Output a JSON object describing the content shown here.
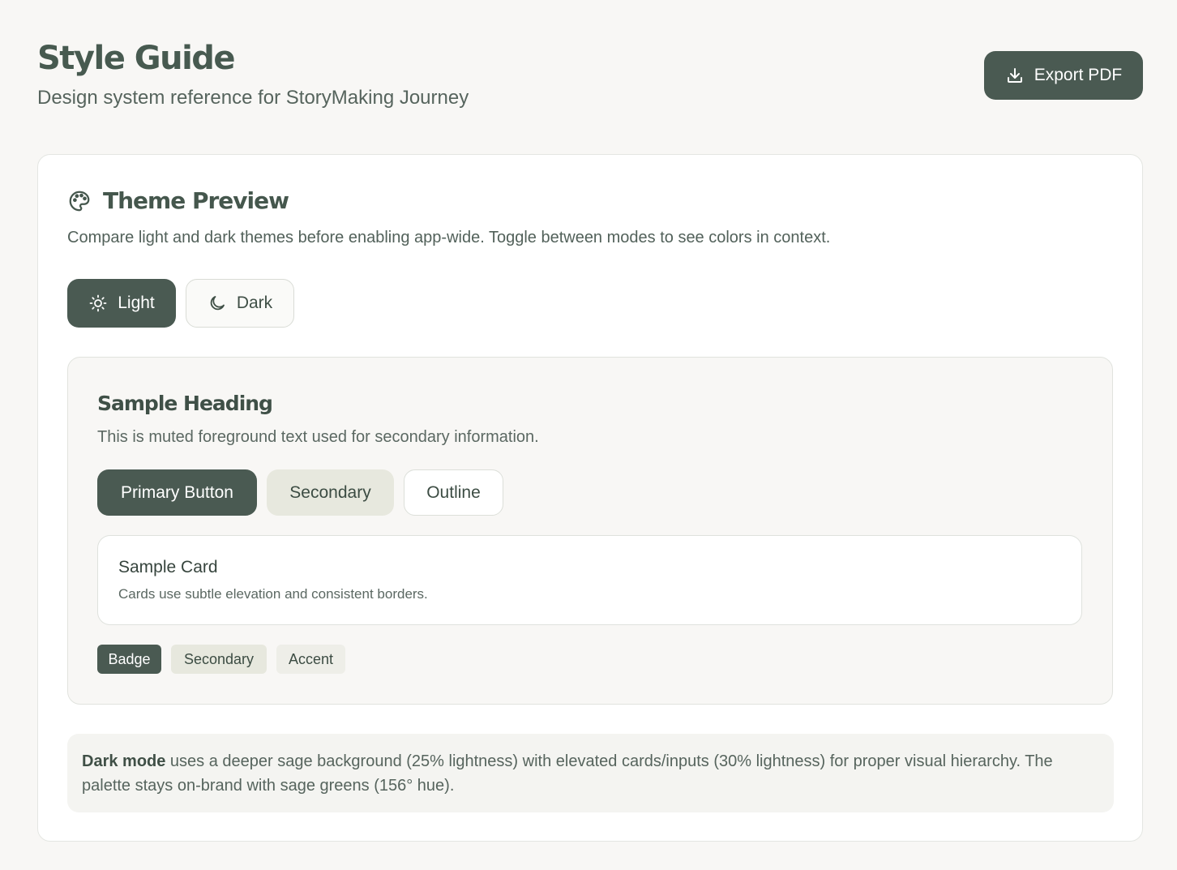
{
  "header": {
    "title": "Style Guide",
    "subtitle": "Design system reference for StoryMaking Journey",
    "export_label": "Export PDF",
    "export_icon": "download-icon"
  },
  "theme_preview": {
    "icon": "palette-icon",
    "title": "Theme Preview",
    "description": "Compare light and dark themes before enabling app-wide. Toggle between modes to see colors in context.",
    "modes": [
      {
        "label": "Light",
        "icon": "sun-icon",
        "selected": true
      },
      {
        "label": "Dark",
        "icon": "moon-icon",
        "selected": false
      }
    ],
    "sample": {
      "heading": "Sample Heading",
      "muted_text": "This is muted foreground text used for secondary information.",
      "buttons": {
        "primary": "Primary Button",
        "secondary": "Secondary",
        "outline": "Outline"
      },
      "card": {
        "title": "Sample Card",
        "description": "Cards use subtle elevation and consistent borders."
      },
      "badges": [
        "Badge",
        "Secondary",
        "Accent"
      ]
    },
    "note": {
      "bold": "Dark mode",
      "text": " uses a deeper sage background (25% lightness) with elevated cards/inputs (30% lightness) for proper visual hierarchy. The palette stays on-brand with sage greens (156° hue)."
    }
  },
  "colors": {
    "primary": "#4a5a52",
    "secondary": "#e7e8de",
    "background": "#f8f7f5",
    "card": "#ffffff",
    "heading": "#45574d",
    "muted": "#5b6862"
  }
}
